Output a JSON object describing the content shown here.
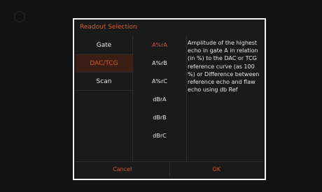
{
  "dialog": {
    "title": "Readout Selection",
    "gate_items": [
      "Gate",
      "DAC/TCG",
      "Scan"
    ],
    "readout_items": [
      "A%rA",
      "A%rB",
      "A%rC",
      "dBrA",
      "dBrB",
      "dBrC"
    ],
    "description": "Amplitude of the highest echo in gate A in relation (in %) to the DAC or TCG reference curve (as 100 %) or Difference between reference echo and flaw echo using db Ref",
    "cancel_label": "Cancel",
    "ok_label": "OK"
  },
  "colors": {
    "accent": "#d85a2a",
    "text": "#e6e6e6",
    "frame": "#f2f2f2",
    "background": "#111111"
  }
}
